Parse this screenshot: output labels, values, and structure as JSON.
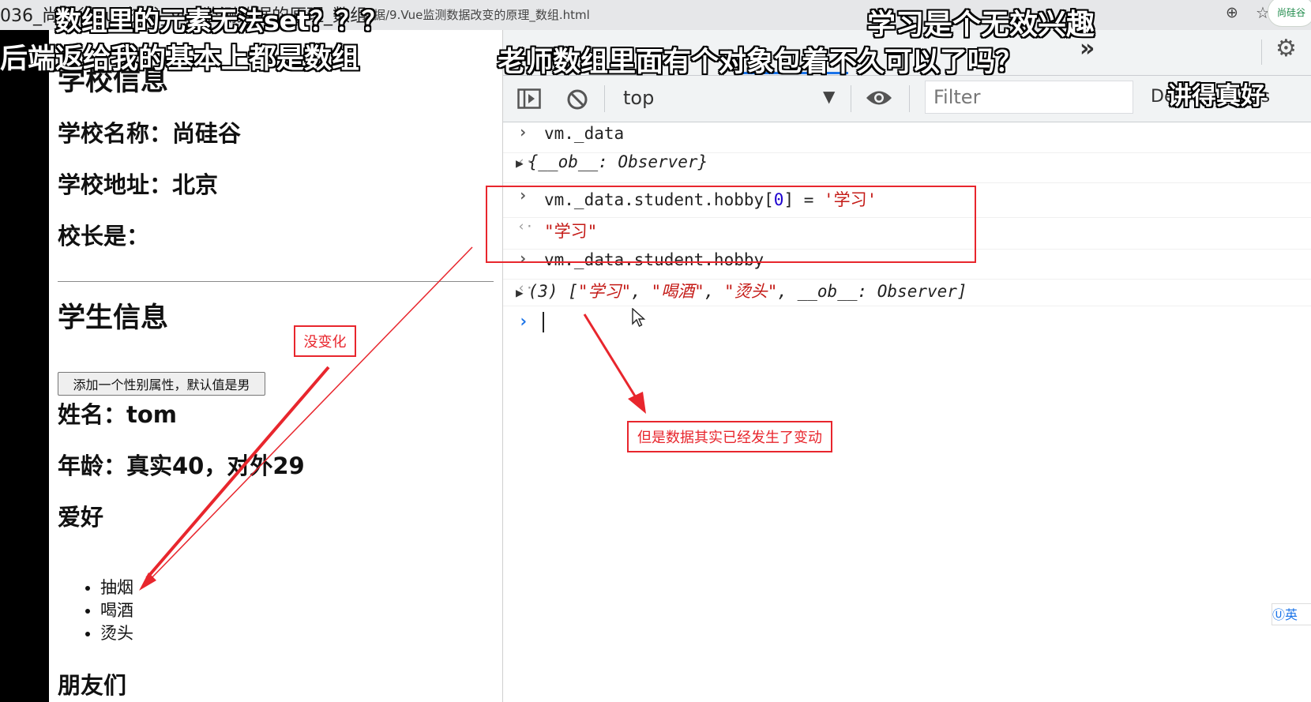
{
  "browser": {
    "title": "036_尚硅谷Vue技术_Vue监测数据的原理_数组",
    "path": "数据/9.Vue监测数据改变的原理_数组.html",
    "zoom_icon": "zoom-icon",
    "star_icon": "star-icon",
    "site_logo": "尚硅谷"
  },
  "page": {
    "school_heading": "学校信息",
    "school_name": "学校名称：尚硅谷",
    "school_address": "学校地址：北京",
    "principal": "校长是：",
    "student_heading": "学生信息",
    "add_sex_button": "添加一个性别属性，默认值是男",
    "name": "姓名：tom",
    "age": "年龄：真实40，对外29",
    "hobby_heading": "爱好",
    "hobbies": [
      "抽烟",
      "喝酒",
      "烫头"
    ],
    "friends_heading": "朋友们"
  },
  "devtools": {
    "context": "top",
    "filter_placeholder": "Filter",
    "levels": "Default levels",
    "console": {
      "row1_input": "vm._data",
      "row1_output": "{__ob__: Observer}",
      "row2_input_pre": "vm._data.student.hobby[",
      "row2_input_index": "0",
      "row2_input_mid": "] = ",
      "row2_input_value": "'学习'",
      "row2_output": "\"学习\"",
      "row3_input": "vm._data.student.hobby",
      "row3_out_len": "(3) [",
      "row3_out_v1": "\"学习\"",
      "row3_out_sep": ", ",
      "row3_out_v2": "\"喝酒\"",
      "row3_out_v3": "\"烫头\"",
      "row3_out_tail": ", __ob__: Observer]"
    }
  },
  "ime": "英",
  "subtitles": {
    "s1": "数组里的元素无法set？？？",
    "s2": "后端返给我的基本上都是数组",
    "s3": "学习是个无效兴趣",
    "s4": "老师数组里面有个对象包着不久可以了吗？",
    "s5": "讲得真好"
  },
  "annotations": {
    "no_change": "没变化",
    "data_changed": "但是数据其实已经发生了变动"
  },
  "colors": {
    "annotation": "#e8262d",
    "console_string": "#c41a16",
    "console_number": "#1c00cf",
    "active_tab": "#1a73e8"
  }
}
